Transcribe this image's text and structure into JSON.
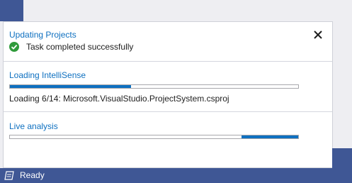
{
  "colors": {
    "accent": "#0e70c0",
    "status_bar": "#3f5795",
    "success": "#2f9a3a",
    "popup_bg": "#ffffff"
  },
  "popup": {
    "close_icon": "close-icon",
    "updating": {
      "title": "Updating Projects",
      "status_icon": "check-circle-icon",
      "status_text": "Task completed successfully"
    },
    "intellisense": {
      "title": "Loading IntelliSense",
      "progress_fraction": 0.42,
      "detail": "Loading 6/14: Microsoft.VisualStudio.ProjectSystem.csproj"
    },
    "live_analysis": {
      "title": "Live analysis",
      "indeterminate": true
    }
  },
  "status_bar": {
    "icon": "output-window-icon",
    "text": "Ready"
  }
}
